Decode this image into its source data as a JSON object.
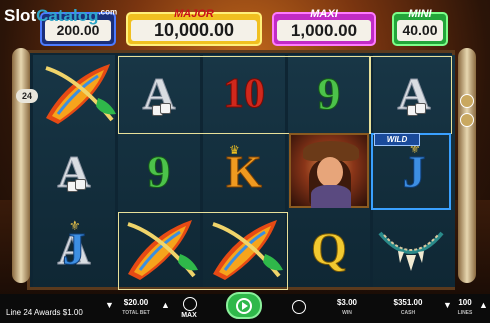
{
  "watermark": {
    "part1": "Slot",
    "part2": "Catalog",
    "suffix": ".com"
  },
  "jackpots": {
    "grand": {
      "label": "",
      "value": "200.00"
    },
    "major": {
      "label": "MAJOR",
      "value": "10,000.00"
    },
    "maxi": {
      "label": "MAXI",
      "value": "1,000.00"
    },
    "mini": {
      "label": "MINI",
      "value": "40.00"
    }
  },
  "side": {
    "lines_badge": "24"
  },
  "reels": [
    [
      "Feather Wild",
      "A",
      "A"
    ],
    [
      "A",
      "9",
      "Feather Wild"
    ],
    [
      "10",
      "K",
      "Feather Wild"
    ],
    [
      "9",
      "Cowgirl",
      "Q"
    ],
    [
      "A",
      "J",
      "Necklace"
    ]
  ],
  "symbols": {
    "wild_tag": "WILD"
  },
  "colors": {
    "spin": "#2fb84a",
    "win_line": "#e8e09a",
    "wild_frame": "#3aa0ff"
  },
  "bottom": {
    "line_award": "Line 24 Awards $1.00",
    "total_bet_value": "$20.00",
    "total_bet_caption": "TOTAL BET",
    "max_label": "MAX",
    "win_value": "$3.00",
    "win_caption": "WIN",
    "cash_value": "$351.00",
    "cash_caption": "CASH",
    "lines_value": "100",
    "lines_caption": "LINES"
  }
}
